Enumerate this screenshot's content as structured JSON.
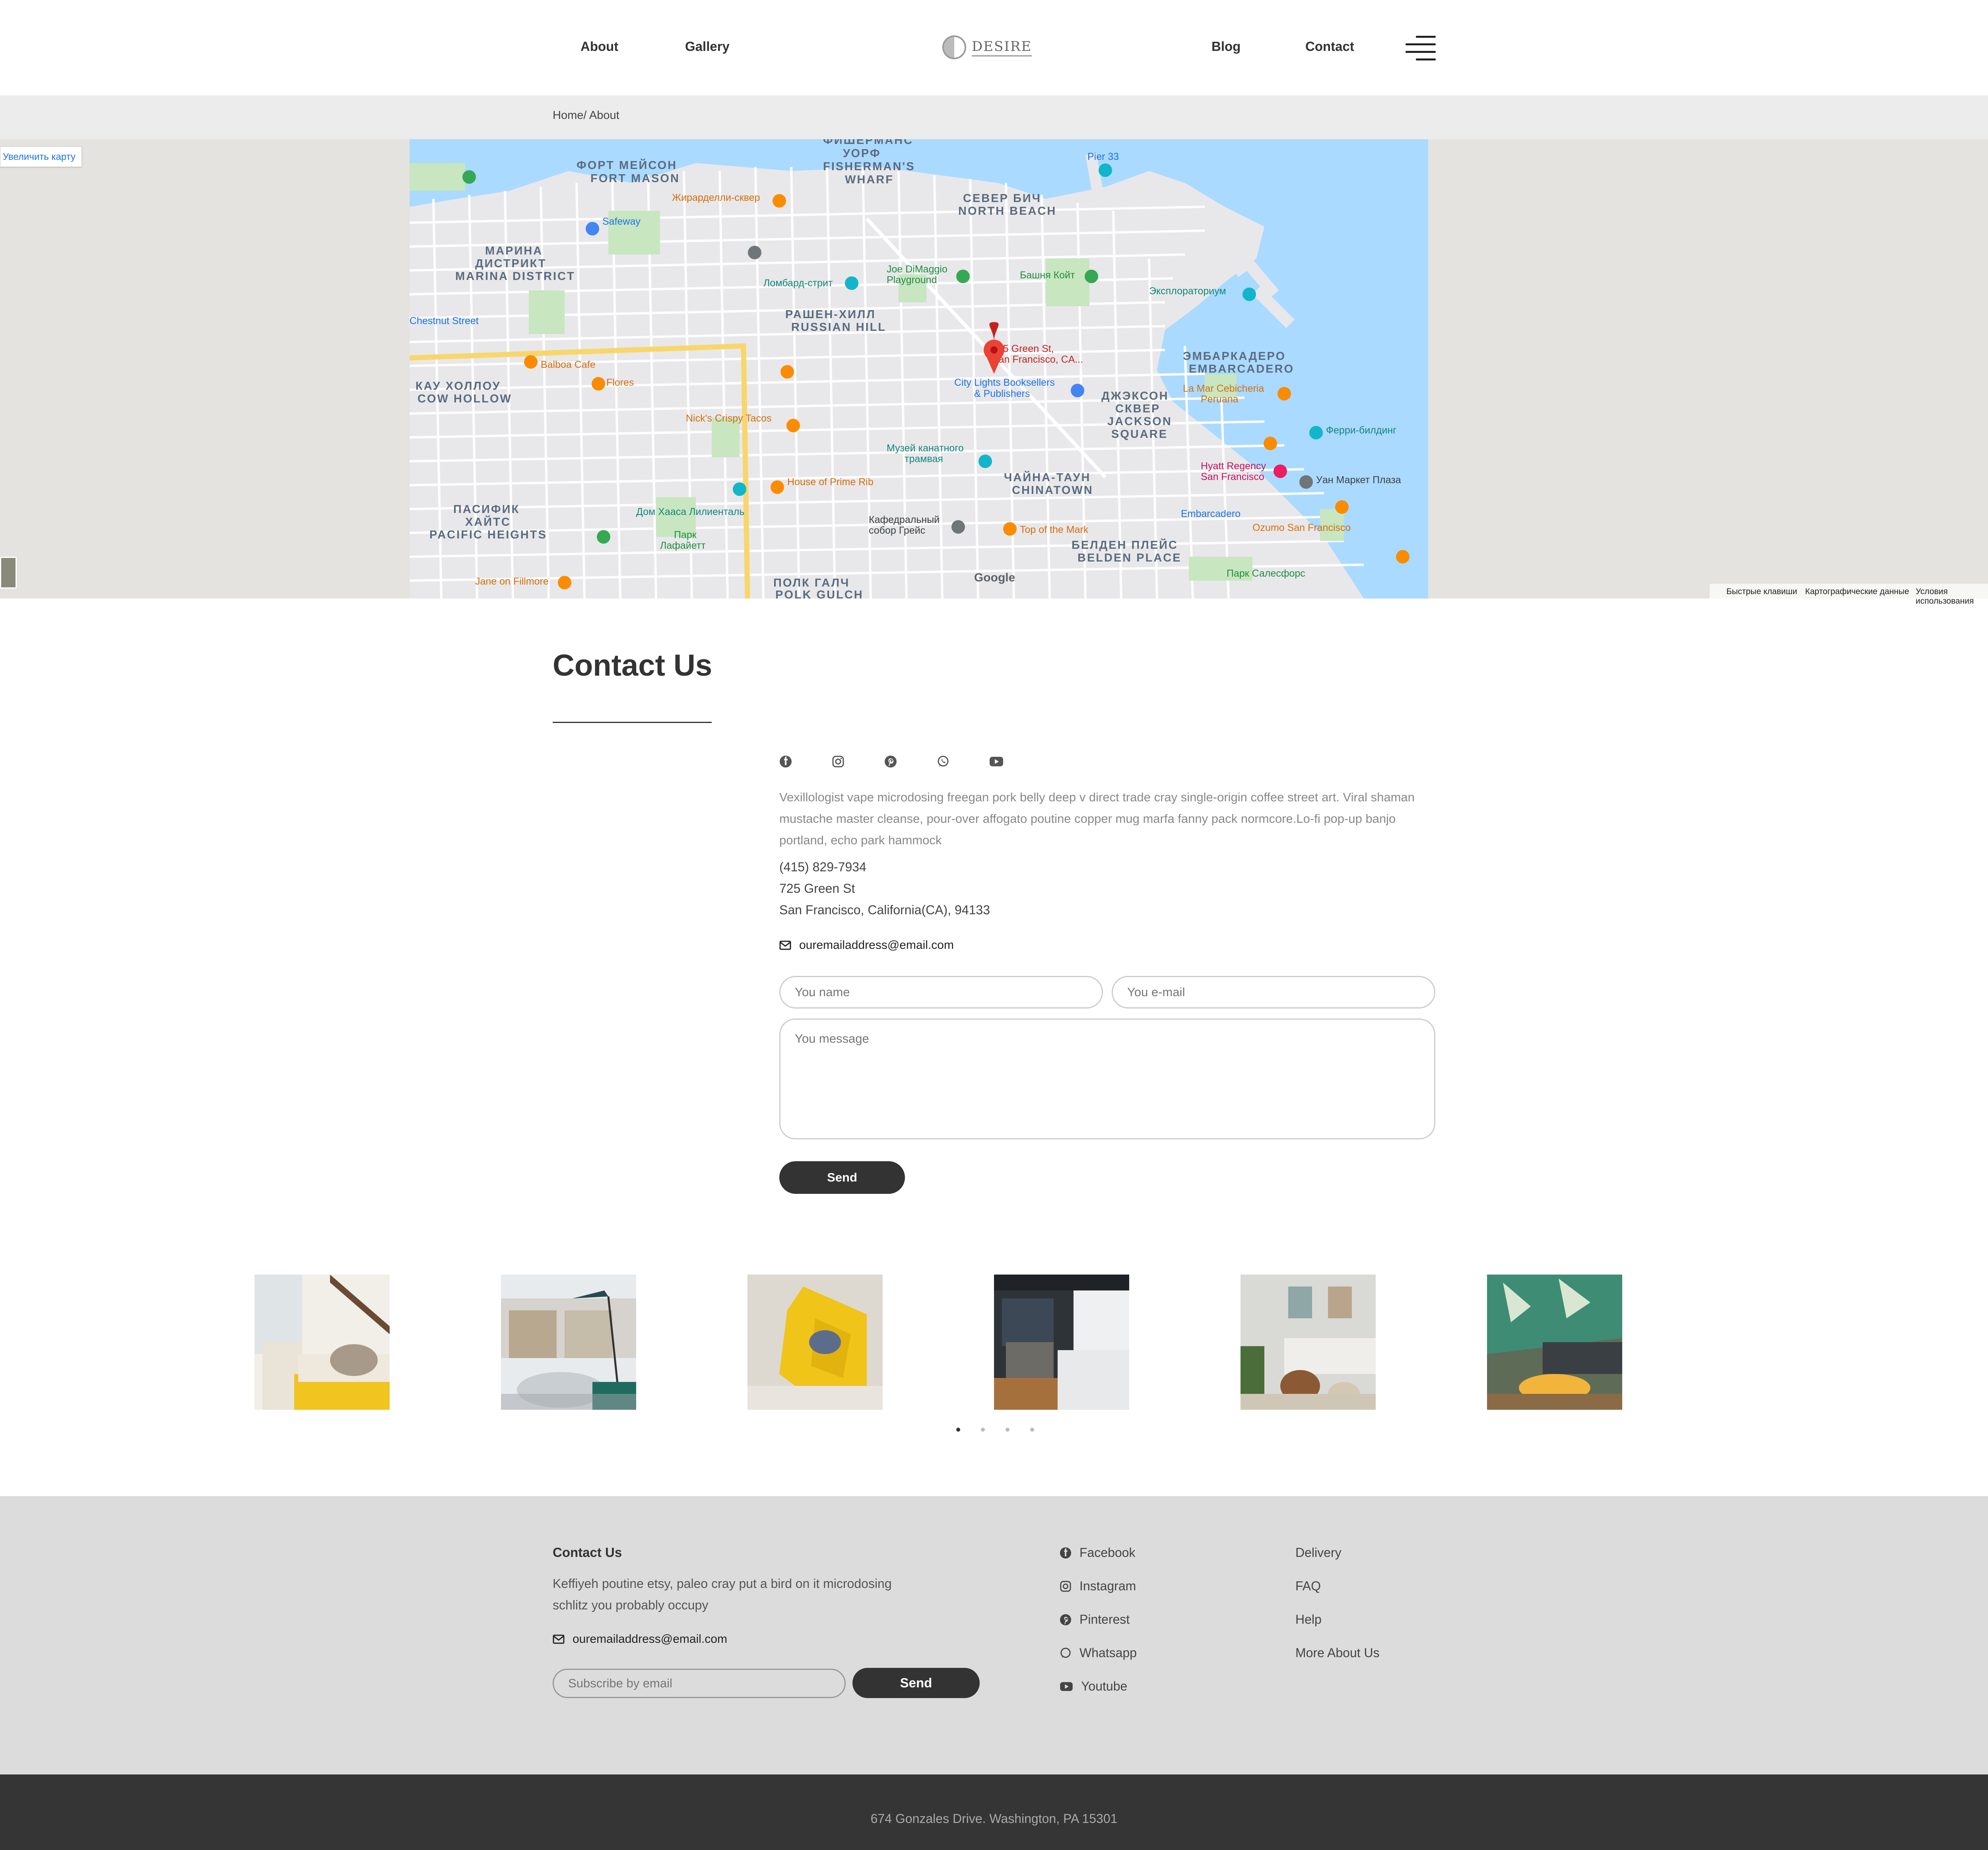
{
  "nav": {
    "left": [
      "About",
      "Gallery"
    ],
    "logo_text": "DESIRE",
    "right": [
      "Blog",
      "Contact"
    ]
  },
  "breadcrumb": "Home/ About",
  "map": {
    "enlarge_label": "Увеличить карту",
    "pin_label_line1": "725 Green St,",
    "pin_label_line2": "San Francisco, CA...",
    "district_labels": [
      "ФОРТ МЕЙСОН",
      "FORT MASON",
      "ФИШЕРМАНС УОРФ",
      "FISHERMAN'S WHARF",
      "СЕВЕР БИЧ",
      "NORTH BEACH",
      "МАРИНА ДИСТРИКТ",
      "MARINA DISTRICT",
      "РАШЕН-ХИЛЛ",
      "RUSSIAN HILL",
      "ЭМБАРКАДЕРО",
      "EMBARCADERO",
      "КАУ ХОЛЛОУ",
      "COW HOLLOW",
      "ДЖЭКСОН СКВЕР",
      "JACKSON SQUARE",
      "ЧАЙНА-ТАУН",
      "CHINATOWN",
      "ПАСИФИК ХАЙТС",
      "PACIFIC HEIGHTS",
      "БЕЛДЕН ПЛЕЙС",
      "BELDEN PLACE",
      "ПОЛК ГАЛЧ",
      "POLK GULCH"
    ],
    "poi_labels": [
      "Жирарделли-сквер",
      "Safeway",
      "Ломбард-стрит",
      "Joe DiMaggio Playground",
      "Башня Койт",
      "Эксплораториум",
      "Balboa Cafe",
      "Flores",
      "City Lights Booksellers & Publishers",
      "La Mar Cebicheria Peruana",
      "Nick's Crispy Tacos",
      "Музей канатного трамвая",
      "Ферри-билдинг",
      "Hyatt Regency San Francisco",
      "House of Prime Rib",
      "Дом Хааса Лилиенталь",
      "Уан Маркет Плаза",
      "Кафедральный собор Грейс",
      "Top of the Mark",
      "Embarcadero",
      "Ozumo San Francisco",
      "Парк Лафайетт",
      "Jane on Fillmore",
      "Парк Салесфорс",
      "Chestnut Street",
      "Pier 33"
    ],
    "footer_links": [
      "Быстрые клавиши",
      "Картографические данные",
      "Условия использования"
    ],
    "google_label": "Google"
  },
  "contact": {
    "title": "Contact Us",
    "social_icons": [
      "facebook-icon",
      "instagram-icon",
      "pinterest-icon",
      "whatsapp-icon",
      "youtube-icon"
    ],
    "description": "Vexillologist vape microdosing freegan pork belly deep v direct trade cray single-origin coffee street art. Viral shaman mustache master cleanse, pour-over affogato poutine copper mug marfa fanny pack normcore.Lo-fi pop-up banjo portland, echo park hammock",
    "phone": "(415) 829-7934",
    "street": "725 Green St",
    "city": "San Francisco, California(CA), 94133",
    "email": "ouremailaddress@email.com",
    "name_placeholder": "You name",
    "email_placeholder": "You e-mail",
    "message_placeholder": "You message",
    "send_label": "Send"
  },
  "gallery": {
    "images": [
      "living-room-yellow-sofa",
      "living-room-shelves-lamp",
      "yellow-chair-topview",
      "modern-kitchen",
      "living-room-plants",
      "living-room-green-wall"
    ],
    "dots": 4,
    "active_dot": 0
  },
  "footer": {
    "title": "Contact Us",
    "description": "Keffiyeh poutine etsy, paleo cray put a bird on it microdosing schlitz you probably occupy",
    "email": "ouremailaddress@email.com",
    "subscribe_placeholder": "Subscribe by email",
    "send_label": "Send",
    "social": [
      "Facebook",
      "Instagram",
      "Pinterest",
      "Whatsapp",
      "Youtube"
    ],
    "links": [
      "Delivery",
      "FAQ",
      "Help",
      "More About Us"
    ],
    "address": "674 Gonzales Drive. Washington, PA 15301"
  },
  "colors": {
    "dark": "#333333",
    "footer_bg": "#dcdcdc",
    "bottom_bg": "#353535",
    "map_water": "#aadaff",
    "map_park": "#c8e6c0",
    "pin": "#e53935"
  }
}
